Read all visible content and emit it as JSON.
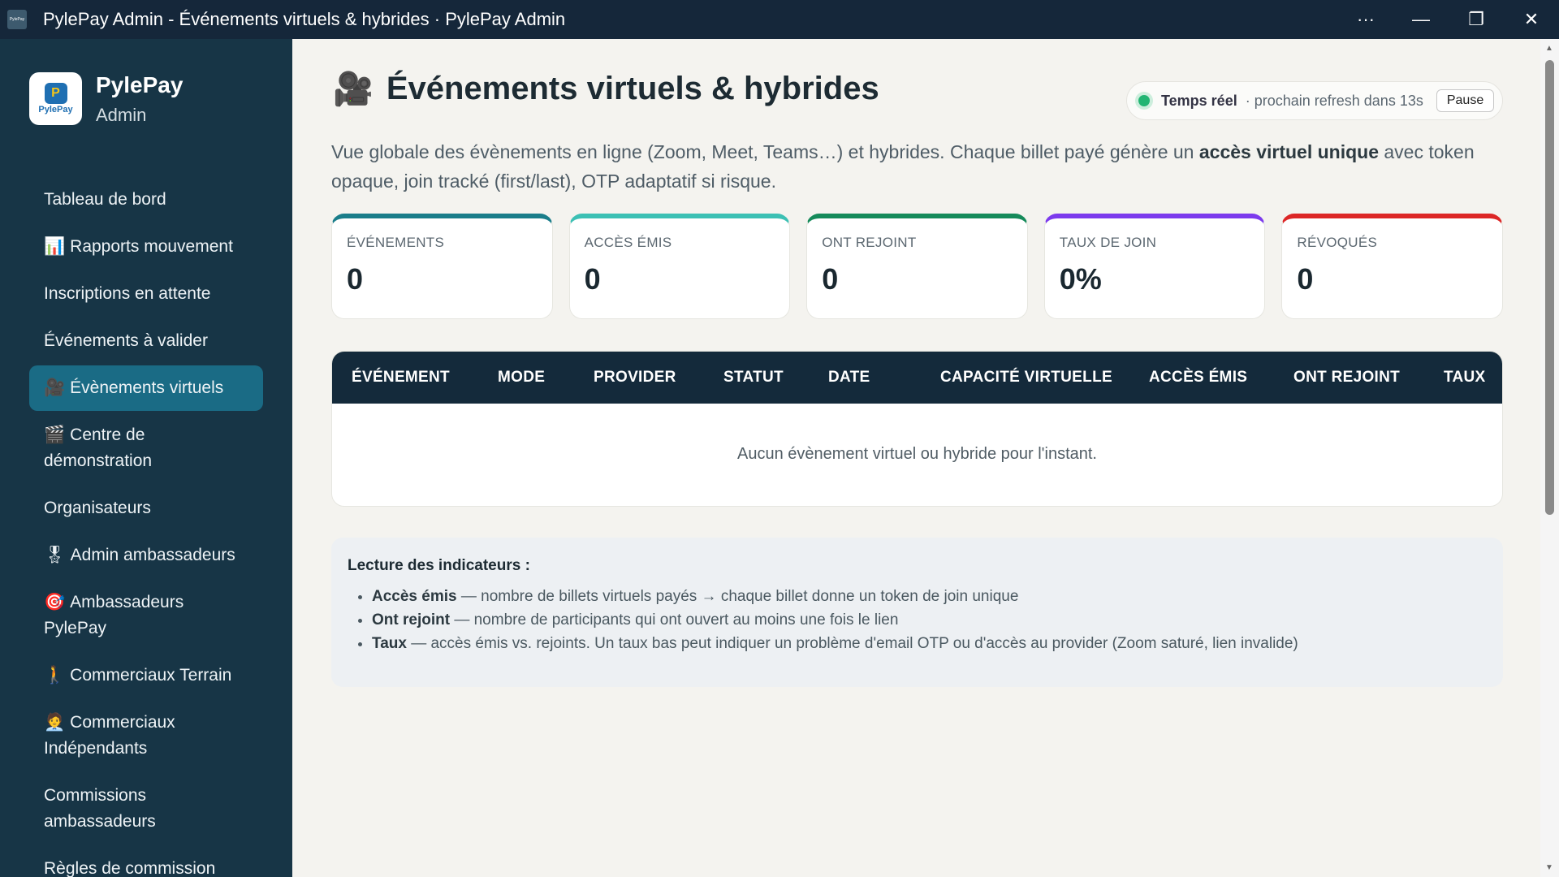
{
  "window": {
    "title": "PylePay Admin - Événements virtuels & hybrides · PylePay Admin",
    "app_icon_text": "PylePay",
    "controls": {
      "more": "···",
      "minimize": "—",
      "restore": "❐",
      "close": "✕"
    }
  },
  "brand": {
    "name": "PylePay",
    "sub": "Admin",
    "logo_mark": "P",
    "logo_word": "PylePay"
  },
  "sidebar": {
    "items": [
      {
        "label": "Tableau de bord",
        "emoji": ""
      },
      {
        "label": "Rapports mouvement",
        "emoji": "📊"
      },
      {
        "label": "Inscriptions en attente",
        "emoji": ""
      },
      {
        "label": "Événements à valider",
        "emoji": ""
      },
      {
        "label": "Évènements virtuels",
        "emoji": "🎥"
      },
      {
        "label": "Centre de démonstration",
        "emoji": "🎬"
      },
      {
        "label": "Organisateurs",
        "emoji": ""
      },
      {
        "label": "Admin ambassadeurs",
        "emoji": "🎖"
      },
      {
        "label": "Ambassadeurs PylePay",
        "emoji": "🎯"
      },
      {
        "label": "Commerciaux Terrain",
        "emoji": "🚶"
      },
      {
        "label": "Commerciaux Indépendants",
        "emoji": "🧑‍💼"
      },
      {
        "label": "Commissions ambassadeurs",
        "emoji": ""
      },
      {
        "label": "Règles de commission",
        "emoji": ""
      }
    ]
  },
  "page": {
    "title_icon": "🎥",
    "title": "Événements virtuels & hybrides",
    "description_part1": "Vue globale des évènements en ligne (Zoom, Meet, Teams…) et hybrides. Chaque billet payé génère un ",
    "description_bold": "accès virtuel unique",
    "description_part2": " avec token opaque, join tracké (first/last), OTP adaptatif si risque."
  },
  "realtime": {
    "label": "Temps réel",
    "next": "· prochain refresh dans 13s",
    "pause_label": "Pause"
  },
  "stats": [
    {
      "label": "ÉVÉNEMENTS",
      "value": "0",
      "color": "#1a7d8a"
    },
    {
      "label": "ACCÈS ÉMIS",
      "value": "0",
      "color": "#3cc0b4"
    },
    {
      "label": "ONT REJOINT",
      "value": "0",
      "color": "#158a5a"
    },
    {
      "label": "TAUX DE JOIN",
      "value": "0%",
      "color": "#7c3aed"
    },
    {
      "label": "RÉVOQUÉS",
      "value": "0",
      "color": "#dc2626"
    }
  ],
  "table": {
    "headers": [
      "ÉVÉNEMENT",
      "MODE",
      "PROVIDER",
      "STATUT",
      "DATE",
      "CAPACITÉ VIRTUELLE",
      "ACCÈS ÉMIS",
      "ONT REJOINT",
      "TAUX"
    ],
    "empty_text": "Aucun évènement virtuel ou hybride pour l'instant."
  },
  "legend": {
    "title": "Lecture des indicateurs :",
    "items": [
      {
        "term": "Accès émis",
        "text": " — nombre de billets virtuels payés → chaque billet donne un token de join unique"
      },
      {
        "term": "Ont rejoint",
        "text": " — nombre de participants qui ont ouvert au moins une fois le lien"
      },
      {
        "term": "Taux",
        "text": " — accès émis vs. rejoints. Un taux bas peut indiquer un problème d'email OTP ou d'accès au provider (Zoom saturé, lien invalide)"
      }
    ]
  }
}
